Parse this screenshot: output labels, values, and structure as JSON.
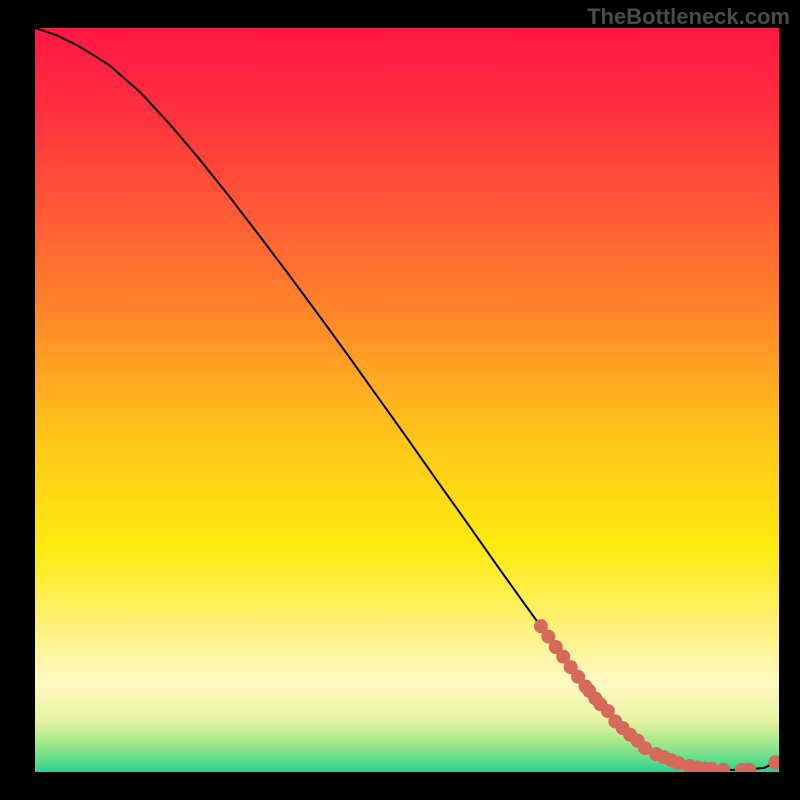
{
  "watermark": "TheBottleneck.com",
  "chart_data": {
    "type": "line",
    "title": "",
    "xlabel": "",
    "ylabel": "",
    "xlim": [
      0,
      100
    ],
    "ylim": [
      0,
      100
    ],
    "gradient_stops": [
      {
        "offset": 0.0,
        "color": "#ff1744"
      },
      {
        "offset": 0.1,
        "color": "#ff2d3f"
      },
      {
        "offset": 0.25,
        "color": "#ff5a36"
      },
      {
        "offset": 0.4,
        "color": "#ff8c28"
      },
      {
        "offset": 0.55,
        "color": "#ffc61a"
      },
      {
        "offset": 0.7,
        "color": "#ffeb0f"
      },
      {
        "offset": 0.8,
        "color": "#fff176"
      },
      {
        "offset": 0.88,
        "color": "#fff9c4"
      },
      {
        "offset": 0.93,
        "color": "#e8f5a0"
      },
      {
        "offset": 0.96,
        "color": "#a5e88c"
      },
      {
        "offset": 0.99,
        "color": "#4cd98c"
      },
      {
        "offset": 1.0,
        "color": "#1fd1a0"
      }
    ],
    "curve": {
      "x": [
        0,
        3,
        6,
        10,
        14,
        18,
        22,
        26,
        30,
        34,
        38,
        42,
        46,
        50,
        54,
        58,
        62,
        66,
        70,
        74,
        78,
        82,
        85,
        88,
        90,
        92,
        94,
        96,
        98,
        100
      ],
      "y": [
        100,
        99,
        97.5,
        95,
        91.5,
        87.2,
        82.5,
        77.5,
        72.3,
        67,
        61.6,
        56.1,
        50.5,
        44.9,
        39.2,
        33.6,
        27.9,
        22.3,
        16.8,
        11.5,
        6.8,
        3.2,
        1.6,
        0.8,
        0.45,
        0.3,
        0.28,
        0.35,
        0.55,
        1.5
      ]
    },
    "markers": {
      "x": [
        68,
        69,
        70,
        71,
        72,
        73,
        74,
        74.5,
        75.3,
        76,
        77,
        78,
        79,
        80,
        81,
        82,
        83.5,
        84.5,
        85.5,
        86.5,
        88,
        89,
        90,
        91,
        92.5,
        95,
        96,
        99.5
      ],
      "y": [
        19.6,
        18.2,
        16.8,
        15.5,
        14.1,
        12.8,
        11.5,
        10.9,
        9.9,
        9.1,
        8.2,
        6.8,
        5.9,
        5.0,
        4.2,
        3.2,
        2.4,
        2.0,
        1.6,
        1.2,
        0.8,
        0.6,
        0.45,
        0.4,
        0.3,
        0.28,
        0.3,
        1.3
      ]
    },
    "marker_color": "#d56a5a",
    "curve_color": "#000000"
  }
}
